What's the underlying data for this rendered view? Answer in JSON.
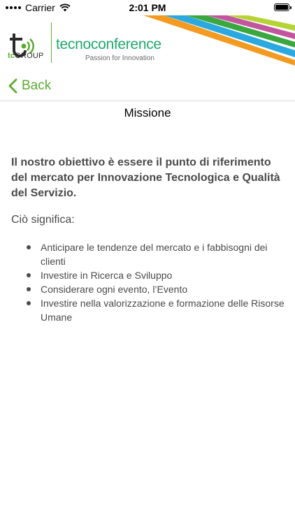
{
  "status_bar": {
    "carrier": "Carrier",
    "time": "2:01 PM"
  },
  "header": {
    "logo_group_tc": "tc",
    "logo_group_rest": "GROUP",
    "brand": "tecnoconference",
    "tagline": "Passion for Innovation",
    "colors": {
      "green": "#5aab2e",
      "teal": "#1fa86d"
    }
  },
  "nav": {
    "back_label": "Back"
  },
  "page": {
    "title": "Missione",
    "lead": "Il nostro obiettivo è essere il punto di riferimento del mercato per Innovazione Tecnologica e Qualità del Servizio.",
    "sub": "Ciò significa:",
    "bullets": [
      "Anticipare le tendenze del mercato e i fabbisogni dei clienti",
      "Investire in Ricerca e Sviluppo",
      "Considerare ogni evento, l’Evento",
      "Investire nella valorizzazione e formazione delle Risorse Umane"
    ]
  }
}
